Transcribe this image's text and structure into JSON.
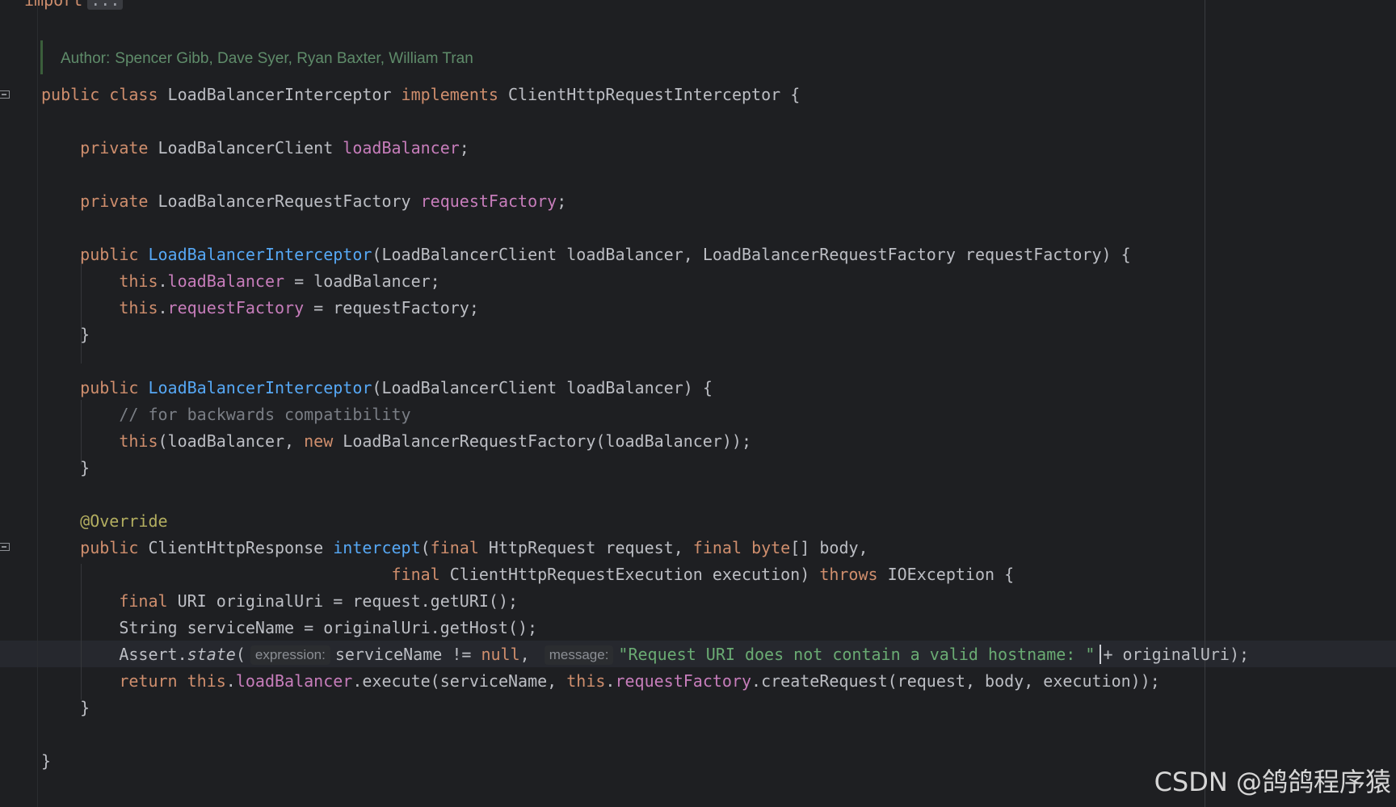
{
  "editor": {
    "import_line": {
      "keyword": "import",
      "collapsed": "..."
    },
    "doc_comment": {
      "tag": "Author:",
      "text": "Spencer Gibb, Dave Syer, Ryan Baxter, William Tran"
    },
    "lines": [
      [
        [
          "kw",
          "public"
        ],
        [
          "t",
          " "
        ],
        [
          "kw",
          "class"
        ],
        [
          "t",
          " LoadBalancerInterceptor "
        ],
        [
          "kw",
          "implements"
        ],
        [
          "t",
          " ClientHttpRequestInterceptor {"
        ]
      ],
      [],
      [
        [
          "t",
          "    "
        ],
        [
          "kw",
          "private"
        ],
        [
          "t",
          " LoadBalancerClient "
        ],
        [
          "fld",
          "loadBalancer"
        ],
        [
          "t",
          ";"
        ]
      ],
      [],
      [
        [
          "t",
          "    "
        ],
        [
          "kw",
          "private"
        ],
        [
          "t",
          " LoadBalancerRequestFactory "
        ],
        [
          "fld",
          "requestFactory"
        ],
        [
          "t",
          ";"
        ]
      ],
      [],
      [
        [
          "t",
          "    "
        ],
        [
          "kw",
          "public"
        ],
        [
          "t",
          " "
        ],
        [
          "fn",
          "LoadBalancerInterceptor"
        ],
        [
          "t",
          "(LoadBalancerClient loadBalancer, LoadBalancerRequestFactory requestFactory) {"
        ]
      ],
      [
        [
          "t",
          "        "
        ],
        [
          "kw",
          "this"
        ],
        [
          "t",
          "."
        ],
        [
          "fld",
          "loadBalancer"
        ],
        [
          "t",
          " = loadBalancer;"
        ]
      ],
      [
        [
          "t",
          "        "
        ],
        [
          "kw",
          "this"
        ],
        [
          "t",
          "."
        ],
        [
          "fld",
          "requestFactory"
        ],
        [
          "t",
          " = requestFactory;"
        ]
      ],
      [
        [
          "t",
          "    }"
        ]
      ],
      [],
      [
        [
          "t",
          "    "
        ],
        [
          "kw",
          "public"
        ],
        [
          "t",
          " "
        ],
        [
          "fn",
          "LoadBalancerInterceptor"
        ],
        [
          "t",
          "(LoadBalancerClient loadBalancer) {"
        ]
      ],
      [
        [
          "t",
          "        "
        ],
        [
          "cmt",
          "// for backwards compatibility"
        ]
      ],
      [
        [
          "t",
          "        "
        ],
        [
          "kw",
          "this"
        ],
        [
          "t",
          "(loadBalancer, "
        ],
        [
          "kw",
          "new"
        ],
        [
          "t",
          " LoadBalancerRequestFactory(loadBalancer));"
        ]
      ],
      [
        [
          "t",
          "    }"
        ]
      ],
      [],
      [
        [
          "t",
          "    "
        ],
        [
          "ann",
          "@Override"
        ]
      ],
      [
        [
          "t",
          "    "
        ],
        [
          "kw",
          "public"
        ],
        [
          "t",
          " ClientHttpResponse "
        ],
        [
          "fn",
          "intercept"
        ],
        [
          "t",
          "("
        ],
        [
          "kw",
          "final"
        ],
        [
          "t",
          " HttpRequest request, "
        ],
        [
          "kw",
          "final"
        ],
        [
          "t",
          " "
        ],
        [
          "kw",
          "byte"
        ],
        [
          "t",
          "[] body,"
        ]
      ],
      [
        [
          "t",
          "                                    "
        ],
        [
          "kw",
          "final"
        ],
        [
          "t",
          " ClientHttpRequestExecution execution) "
        ],
        [
          "kw",
          "throws"
        ],
        [
          "t",
          " IOException {"
        ]
      ],
      [
        [
          "t",
          "        "
        ],
        [
          "kw",
          "final"
        ],
        [
          "t",
          " URI originalUri = request.getURI();"
        ]
      ],
      [
        [
          "t",
          "        String serviceName = originalUri.getHost();"
        ]
      ],
      [
        [
          "t",
          "        Assert."
        ],
        [
          "ital",
          "state"
        ],
        [
          "t",
          "("
        ],
        [
          "hint",
          "expression:"
        ],
        [
          "t",
          "serviceName != "
        ],
        [
          "kw",
          "null"
        ],
        [
          "t",
          ", "
        ],
        [
          "hint",
          "message:"
        ],
        [
          "str",
          "\"Request URI does not contain a valid hostname: \""
        ],
        [
          "caret",
          ""
        ],
        [
          "t",
          "+ originalUri);"
        ]
      ],
      [
        [
          "t",
          "        "
        ],
        [
          "kw",
          "return"
        ],
        [
          "t",
          " "
        ],
        [
          "kw",
          "this"
        ],
        [
          "t",
          "."
        ],
        [
          "fld",
          "loadBalancer"
        ],
        [
          "t",
          ".execute(serviceName, "
        ],
        [
          "kw",
          "this"
        ],
        [
          "t",
          "."
        ],
        [
          "fld",
          "requestFactory"
        ],
        [
          "t",
          ".createRequest(request, body, execution));"
        ]
      ],
      [
        [
          "t",
          "    }"
        ]
      ],
      [],
      [
        [
          "t",
          "}"
        ]
      ]
    ]
  },
  "watermark": "CSDN @鸽鸽程序猿"
}
